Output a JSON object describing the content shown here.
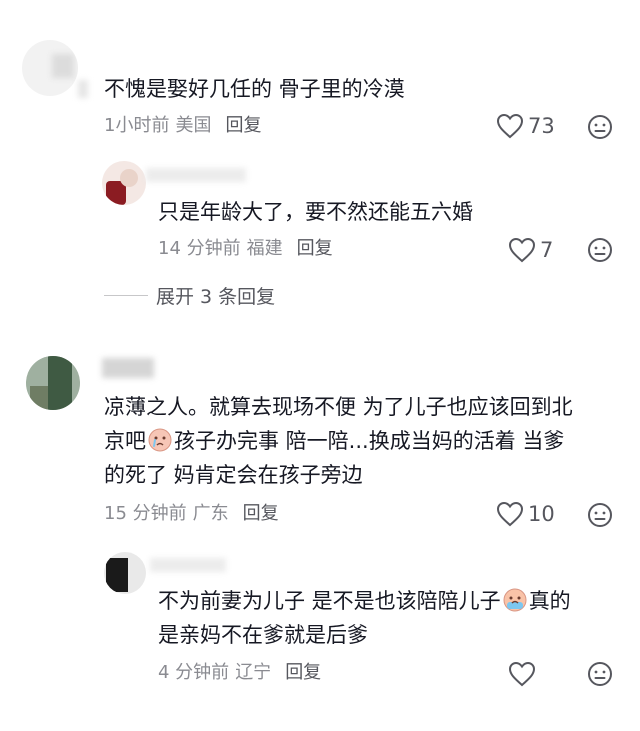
{
  "comments": [
    {
      "text_lines": [
        "不愧是娶好几任的 骨子里的冷漠"
      ],
      "time": "1小时前",
      "location": "美国",
      "reply_label": "回复",
      "likes": "73"
    },
    {
      "text_lines": [
        "只是年龄大了，要不然还能五六婚"
      ],
      "time": "14 分钟前",
      "location": "福建",
      "reply_label": "回复",
      "likes": "7"
    },
    {
      "text_lines": [
        "凉薄之人。就算去现场不便 为了儿子也应该回到北",
        "京吧",
        "孩子办完事 陪一陪...换成当妈的活着 当爹",
        "的死了 妈肯定会在孩子旁边"
      ],
      "time": "15 分钟前",
      "location": "广东",
      "reply_label": "回复",
      "likes": "10"
    },
    {
      "text_lines": [
        "不为前妻为儿子 是不是也该陪陪儿子",
        "真的",
        "是亲妈不在爹就是后爹"
      ],
      "time": "4 分钟前",
      "location": "辽宁",
      "reply_label": "回复",
      "likes": ""
    }
  ],
  "expand_replies": "展开 3 条回复",
  "icons": {
    "like": "heart-outline-icon",
    "dislike": "neutral-face-icon",
    "emoji_1": "crying-face-emoji",
    "emoji_2": "tearful-face-emoji"
  },
  "colors": {
    "text": "#161823",
    "meta": "#8a8b91",
    "icon": "#56575e"
  }
}
